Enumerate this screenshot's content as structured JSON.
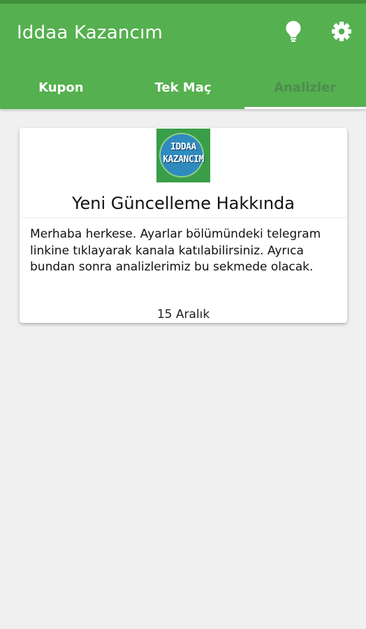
{
  "app": {
    "title": "Iddaa Kazancım"
  },
  "toolbar": {
    "icons": [
      "lightbulb-icon",
      "gear-icon"
    ]
  },
  "tabs": [
    {
      "label": "Kupon",
      "selected": false
    },
    {
      "label": "Tek Maç",
      "selected": false
    },
    {
      "label": "Analizler",
      "selected": true
    }
  ],
  "card": {
    "logo": {
      "line1": "IDDAA",
      "line2": "KAZANCIM"
    },
    "title": "Yeni Güncelleme Hakkında",
    "body": "Merhaba herkese. Ayarlar bölümündeki telegram linkine tıklayarak kanala katılabilirsiniz. Ayrıca bundan sonra analizlerimiz bu sekmede olacak.",
    "date": "15 Aralık"
  },
  "colors": {
    "primary": "#55b04f",
    "primary_dark": "#3f8f3b",
    "background": "#f0f0f0",
    "card": "#ffffff"
  }
}
